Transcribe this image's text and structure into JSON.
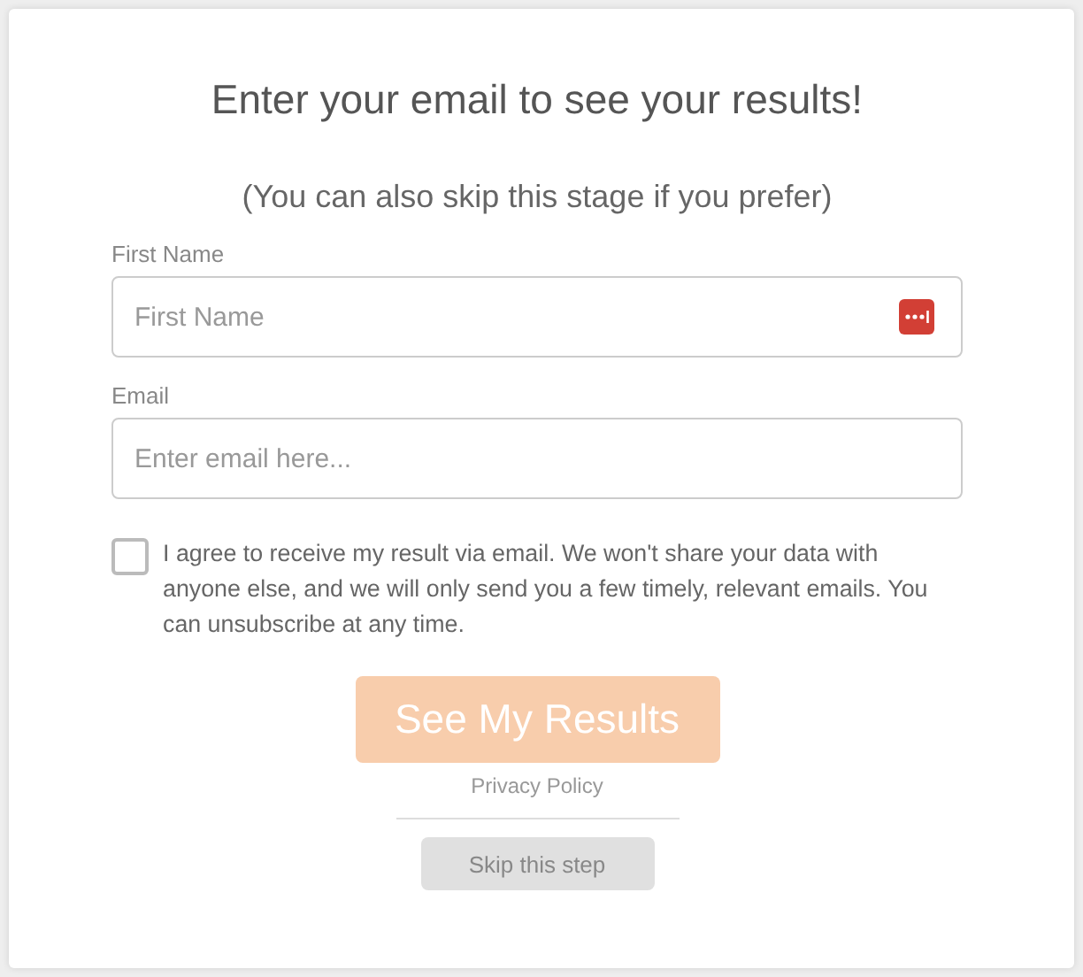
{
  "title": "Enter your email to see your results!",
  "subtitle": "(You can also skip this stage if you prefer)",
  "fields": [
    {
      "label": "First Name",
      "placeholder": "First Name",
      "password_manager": true
    },
    {
      "label": "Email",
      "placeholder": "Enter email here...",
      "password_manager": false
    }
  ],
  "consent": {
    "checked": false,
    "text": "I agree to receive my result via email. We won't share your data with anyone else, and we will only send you a few timely, relevant emails. You can unsubscribe at any time."
  },
  "submit": {
    "label": "See My Results",
    "disabled": true
  },
  "privacy_link": "Privacy Policy",
  "skip_button": "Skip this step"
}
